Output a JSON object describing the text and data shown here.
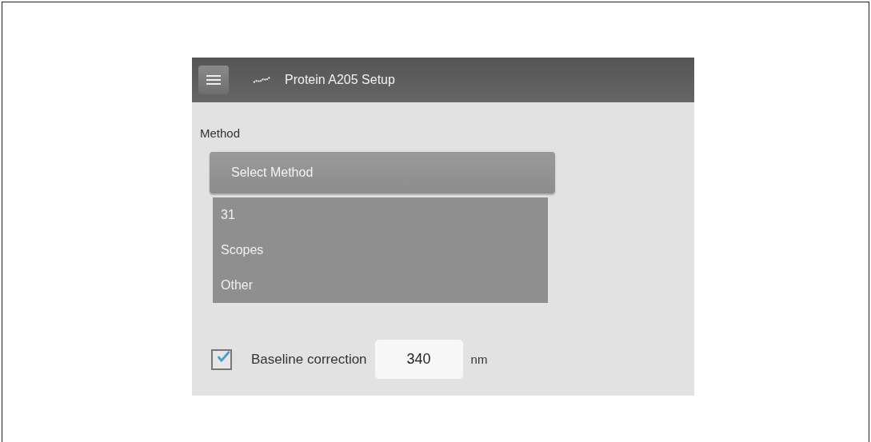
{
  "app_bar": {
    "title": "Protein A205 Setup"
  },
  "method": {
    "label": "Method",
    "dropdown": {
      "placeholder": "Select Method",
      "expanded": true,
      "options": [
        {
          "label": "31"
        },
        {
          "label": "Scopes"
        },
        {
          "label": "Other"
        }
      ]
    }
  },
  "baseline_correction": {
    "label": "Baseline correction",
    "checked": true,
    "value": "340",
    "unit": "nm"
  }
}
